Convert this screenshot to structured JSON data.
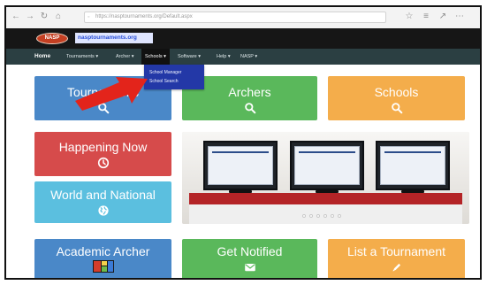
{
  "browser": {
    "url": "https://nasptournaments.org/Default.aspx",
    "icons": {
      "back": "←",
      "forward": "→",
      "reload": "↻",
      "home": "⌂",
      "bookmark": "☆",
      "hub": "≡",
      "share": "↗",
      "more": "⋯"
    }
  },
  "site": {
    "logo_text": "NASP",
    "title": "nasptournaments.org"
  },
  "nav": {
    "items": [
      {
        "label": "Home"
      },
      {
        "label": "Tournaments ▾"
      },
      {
        "label": "Archer ▾"
      },
      {
        "label": "Schools ▾"
      },
      {
        "label": "Software ▾"
      },
      {
        "label": "Help ▾"
      },
      {
        "label": "NASP ▾"
      }
    ],
    "dropdown": [
      {
        "label": "School Manager"
      },
      {
        "label": "School Search"
      }
    ]
  },
  "tiles": [
    {
      "label": "Tournaments",
      "icon": "search-icon",
      "color": "#4a88c8"
    },
    {
      "label": "Archers",
      "icon": "search-icon",
      "color": "#5ab85b"
    },
    {
      "label": "Schools",
      "icon": "search-icon",
      "color": "#f4ad4b"
    },
    {
      "label": "Happening Now",
      "icon": "clock-icon",
      "color": "#d64b4b"
    },
    {
      "label": "World and National",
      "icon": "globe-icon",
      "color": "#5bbfdf"
    },
    {
      "label": "Academic Archer",
      "icon": "image-icon",
      "color": "#4a88c8"
    },
    {
      "label": "Get Notified",
      "icon": "envelope-icon",
      "color": "#5ab85b"
    },
    {
      "label": "List a Tournament",
      "icon": "pencil-icon",
      "color": "#f4ad4b"
    }
  ],
  "annotation": {
    "arrow_color": "#e3241b"
  }
}
